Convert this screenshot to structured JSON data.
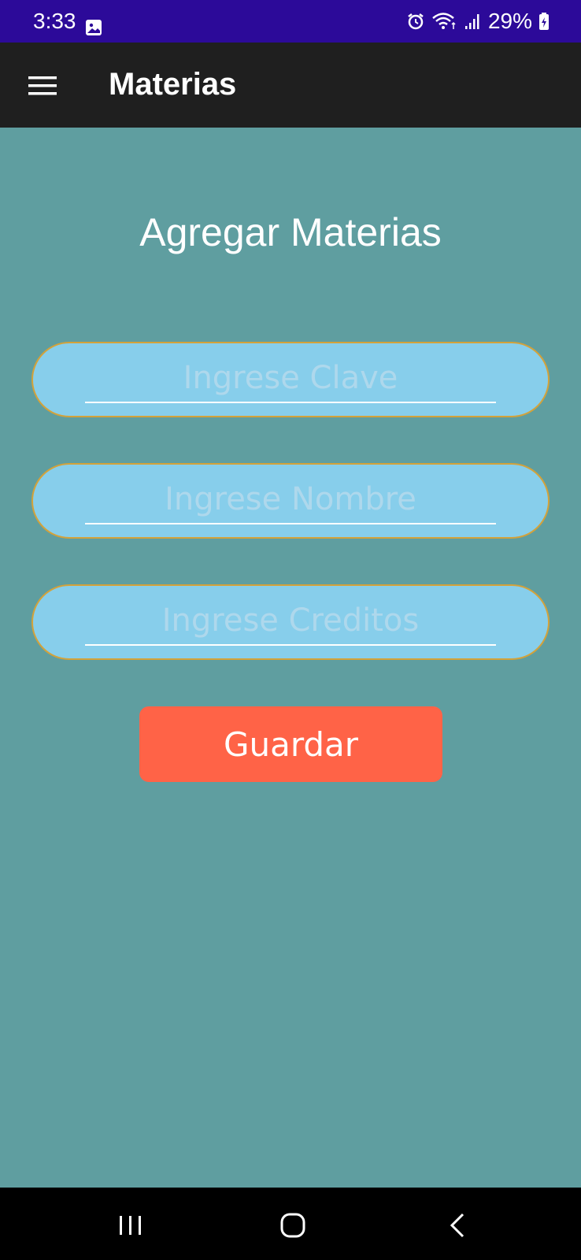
{
  "status_bar": {
    "time": "3:33",
    "battery_text": "29%",
    "background": "#2c0a99",
    "icons": [
      "gallery-icon",
      "alarm-icon",
      "wifi-icon",
      "signal-icon",
      "battery-icon"
    ]
  },
  "app_bar": {
    "title": "Materias",
    "menu_icon": "menu-icon",
    "background": "#1f1f1f"
  },
  "form": {
    "heading": "Agregar Materias",
    "fields": [
      {
        "placeholder": "Ingrese Clave",
        "value": ""
      },
      {
        "placeholder": "Ingrese Nombre",
        "value": ""
      },
      {
        "placeholder": "Ingrese Creditos",
        "value": ""
      }
    ],
    "save_label": "Guardar",
    "colors": {
      "background": "#5f9ea0",
      "field_fill": "#87ceeb",
      "field_border": "#d3a23a",
      "button": "#ff6347"
    }
  },
  "nav_bar": {
    "buttons": [
      "recents-icon",
      "home-icon",
      "back-icon"
    ]
  }
}
